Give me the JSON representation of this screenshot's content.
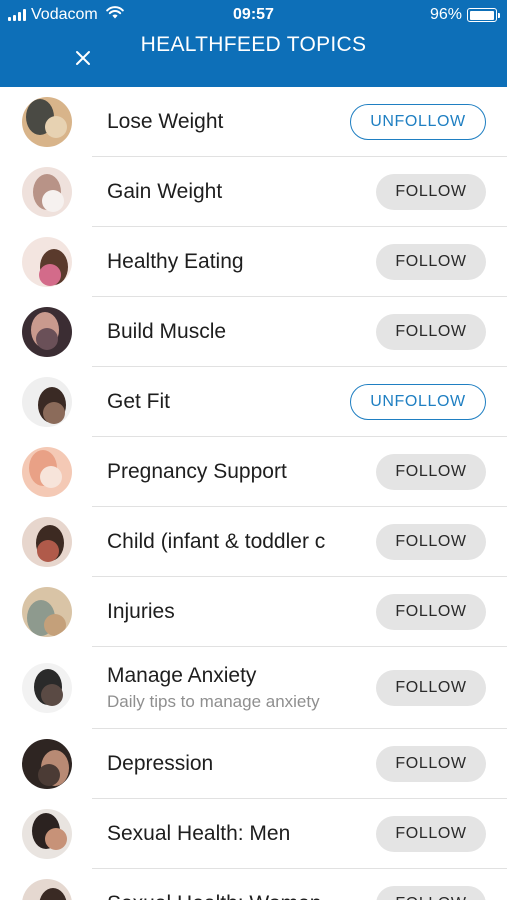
{
  "status_bar": {
    "carrier": "Vodacom",
    "time": "09:57",
    "battery_percent": "96%",
    "battery_level": 0.96
  },
  "header": {
    "title": "HEALTHFEED TOPICS",
    "close_icon": "close-icon",
    "background_color": "#0d6fb8"
  },
  "colors": {
    "unfollow_accent": "#1f7fc2",
    "follow_button_bg": "#e4e4e4"
  },
  "topics": [
    {
      "name": "Lose Weight",
      "button": "UNFOLLOW",
      "following": true,
      "avatar_colors": [
        "#d8b48a",
        "#4a4a44",
        "#e7d2b2"
      ]
    },
    {
      "name": "Gain Weight",
      "button": "FOLLOW",
      "following": false,
      "avatar_colors": [
        "#efe1dc",
        "#b89387",
        "#f6f1ef"
      ]
    },
    {
      "name": "Healthy Eating",
      "button": "FOLLOW",
      "following": false,
      "avatar_colors": [
        "#f3e5e0",
        "#5a3a2c",
        "#d36b8a"
      ]
    },
    {
      "name": "Build Muscle",
      "button": "FOLLOW",
      "following": false,
      "avatar_colors": [
        "#3b2d33",
        "#c99a8e",
        "#6a5058"
      ]
    },
    {
      "name": "Get Fit",
      "button": "UNFOLLOW",
      "following": true,
      "avatar_colors": [
        "#efefef",
        "#3a2a24",
        "#8b6b5a"
      ]
    },
    {
      "name": "Pregnancy Support",
      "button": "FOLLOW",
      "following": false,
      "avatar_colors": [
        "#f4c9b5",
        "#e9a186",
        "#f7e4da"
      ]
    },
    {
      "name": "Child (infant & toddler c",
      "button": "FOLLOW",
      "following": false,
      "avatar_colors": [
        "#e7d6cd",
        "#3d2a22",
        "#b05a4a"
      ]
    },
    {
      "name": "Injuries",
      "button": "FOLLOW",
      "following": false,
      "avatar_colors": [
        "#d9c4a6",
        "#8e9a8e",
        "#c4a07a"
      ]
    },
    {
      "name": "Manage Anxiety",
      "subtitle": "Daily tips to manage anxiety",
      "button": "FOLLOW",
      "following": false,
      "avatar_colors": [
        "#f2f2f2",
        "#2a2a2a",
        "#5a4a44"
      ]
    },
    {
      "name": "Depression",
      "button": "FOLLOW",
      "following": false,
      "avatar_colors": [
        "#2e2522",
        "#b88a74",
        "#4b3b35"
      ]
    },
    {
      "name": "Sexual Health: Men",
      "button": "FOLLOW",
      "following": false,
      "avatar_colors": [
        "#e9e4e0",
        "#2b2220",
        "#c79278"
      ]
    },
    {
      "name": "Sexual Health: Women",
      "button": "FOLLOW",
      "following": false,
      "avatar_colors": [
        "#e5d8d0",
        "#3a2a24",
        "#a07460"
      ]
    }
  ]
}
